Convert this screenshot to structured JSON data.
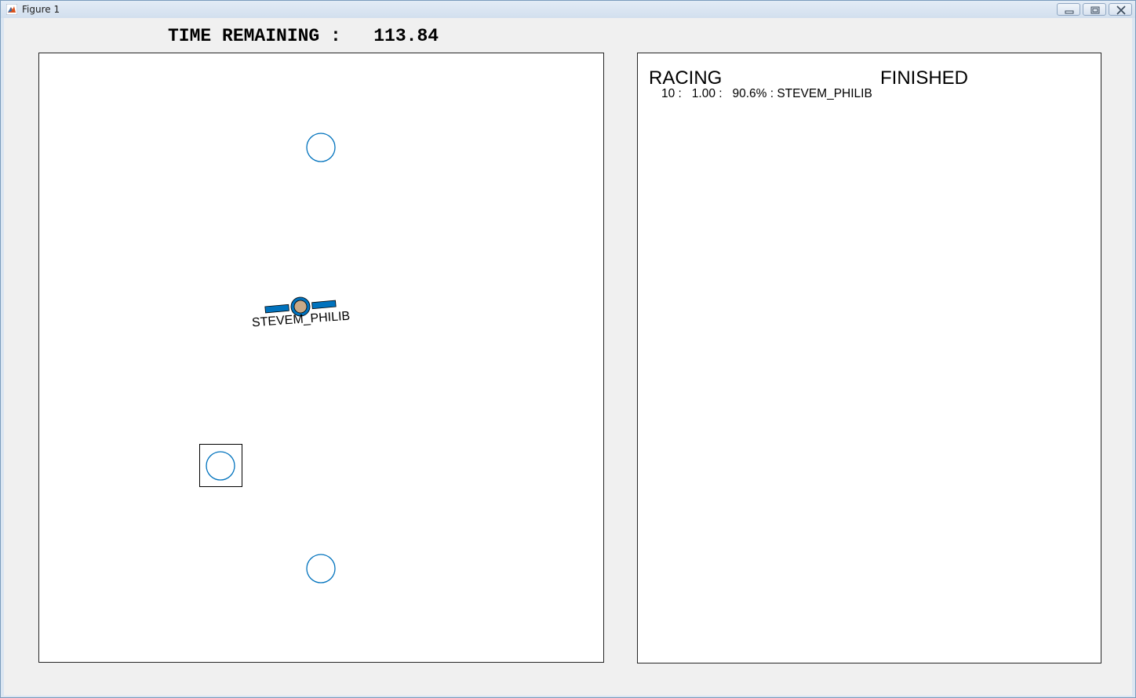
{
  "window": {
    "title": "Figure 1",
    "app_icon": "matlab-icon",
    "controls": [
      "minimize-icon",
      "restore-icon",
      "close-icon"
    ]
  },
  "timer": {
    "label": "TIME REMAINING :   113.84",
    "value": 113.84
  },
  "arena": {
    "ship": {
      "name": "STEVEM_PHILIB",
      "color": "#0072bd",
      "body_color": "#c8a987"
    },
    "checkpoint_color": "#0072bd",
    "checkpoints": [
      "checkpoint-top",
      "checkpoint-target",
      "checkpoint-bottom"
    ]
  },
  "scoreboard": {
    "racing_header": "RACING",
    "finished_header": "FINISHED",
    "racing_entries": [
      {
        "text": "10 :   1.00 :   90.6% : STEVEM_PHILIB"
      }
    ]
  }
}
